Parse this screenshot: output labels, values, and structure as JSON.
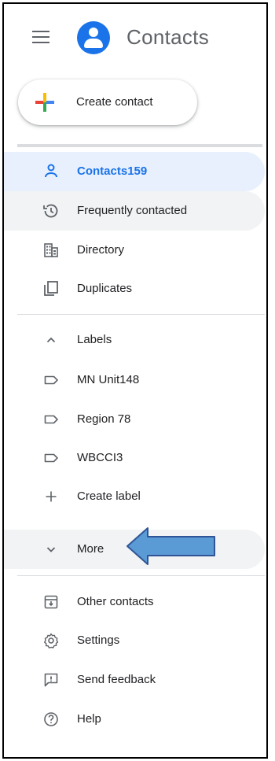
{
  "header": {
    "app_title": "Contacts"
  },
  "create": {
    "label": "Create contact"
  },
  "nav": {
    "contacts": {
      "label": "Contacts",
      "count": "159"
    },
    "frequent": {
      "label": "Frequently contacted"
    },
    "directory": {
      "label": "Directory"
    },
    "duplicates": {
      "label": "Duplicates"
    }
  },
  "labels": {
    "section_label": "Labels",
    "items": [
      {
        "name": "MN Unit",
        "count": "148"
      },
      {
        "name": "Region 7",
        "count": "8"
      },
      {
        "name": "WBCCI",
        "count": "3"
      }
    ],
    "create_label": "Create label"
  },
  "more": {
    "label": "More"
  },
  "footer": {
    "other_contacts": "Other contacts",
    "settings": "Settings",
    "feedback": "Send feedback",
    "help": "Help"
  },
  "colors": {
    "accent": "#1a73e8",
    "active_bg": "#e8f0fe",
    "hover_bg": "#f1f3f4",
    "icon": "#5f6368",
    "annotation_arrow": "#5b9bd5"
  },
  "annotation": {
    "type": "arrow",
    "points_to": "More"
  }
}
